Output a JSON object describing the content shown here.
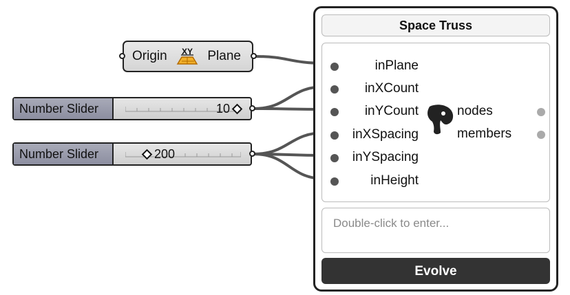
{
  "xy_component": {
    "input_label": "Origin",
    "output_label": "Plane",
    "icon": "xy-plane-icon"
  },
  "sliders": [
    {
      "label": "Number Slider",
      "value": "10",
      "position_fraction": 0.9
    },
    {
      "label": "Number Slider",
      "value": "200",
      "position_fraction": 0.1
    }
  ],
  "truss": {
    "title": "Space Truss",
    "inputs": [
      "inPlane",
      "inXCount",
      "inYCount",
      "inXSpacing",
      "inYSpacing",
      "inHeight"
    ],
    "outputs": [
      "nodes",
      "members"
    ],
    "icon": "elephant-icon",
    "placeholder": "Double-click to enter...",
    "button_label": "Evolve"
  }
}
